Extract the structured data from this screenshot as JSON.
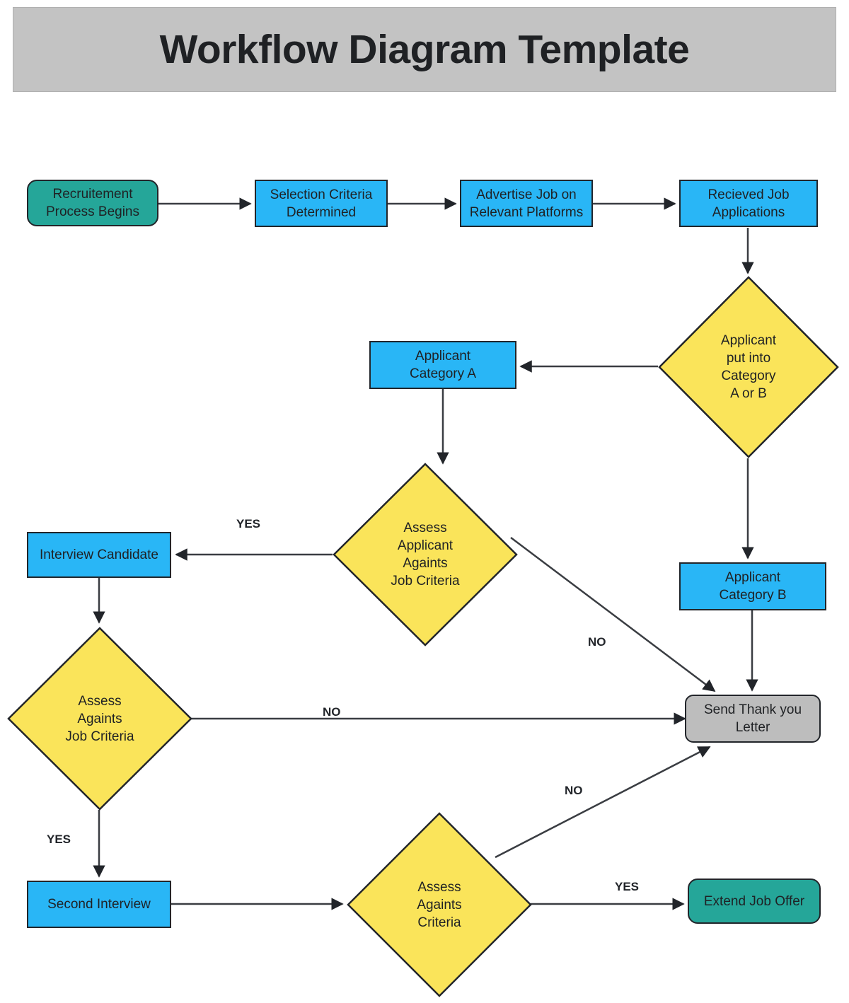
{
  "title": {
    "text": "Workflow Diagram Template"
  },
  "palette": {
    "start_end": "#25a699",
    "process": "#29b6f6",
    "decision": "#fae45a",
    "terminal_gray": "#bdbdbd",
    "banner": "#c3c3c3",
    "stroke": "#22252a",
    "text": "#1f2124"
  },
  "nodes": [
    {
      "id": "recruitment-process-begins",
      "shape": "rounded-rect",
      "color": "start_end",
      "label": "Recruitement\nProcess Begins"
    },
    {
      "id": "selection-criteria-determined",
      "shape": "rect",
      "color": "process",
      "label": "Selection Criteria\nDetermined"
    },
    {
      "id": "advertise-job",
      "shape": "rect",
      "color": "process",
      "label": "Advertise Job on\nRelevant Platforms"
    },
    {
      "id": "recieved-job-applications",
      "shape": "rect",
      "color": "process",
      "label": "Recieved Job\nApplications"
    },
    {
      "id": "applicant-put-into-category",
      "shape": "diamond",
      "color": "decision",
      "label": "Applicant\nput into\nCategory\nA or B"
    },
    {
      "id": "applicant-category-a",
      "shape": "rect",
      "color": "process",
      "label": "Applicant\nCategory A"
    },
    {
      "id": "applicant-category-b",
      "shape": "rect",
      "color": "process",
      "label": "Applicant\nCategory B"
    },
    {
      "id": "assess-applicant-againts-job-criteria",
      "shape": "diamond",
      "color": "decision",
      "label": "Assess\nApplicant\nAgaints\nJob Criteria"
    },
    {
      "id": "interview-candidate",
      "shape": "rect",
      "color": "process",
      "label": "Interview Candidate"
    },
    {
      "id": "assess-againts-job-criteria",
      "shape": "diamond",
      "color": "decision",
      "label": "Assess\nAgaints\nJob Criteria"
    },
    {
      "id": "send-thank-you-letter",
      "shape": "rounded-rect",
      "color": "terminal_gray",
      "label": "Send Thank you\nLetter"
    },
    {
      "id": "second-interview",
      "shape": "rect",
      "color": "process",
      "label": "Second Interview"
    },
    {
      "id": "assess-againts-criteria",
      "shape": "diamond",
      "color": "decision",
      "label": "Assess\nAgaints\nCriteria"
    },
    {
      "id": "extend-job-offer",
      "shape": "rounded-rect",
      "color": "start_end",
      "label": "Extend Job Offer"
    }
  ],
  "node_labels": {
    "recruitment_process_begins_line1": "Recruitement",
    "recruitment_process_begins_line2": "Process Begins",
    "selection_criteria_line1": "Selection Criteria",
    "selection_criteria_line2": "Determined",
    "advertise_job_line1": "Advertise Job on",
    "advertise_job_line2": "Relevant Platforms",
    "recieved_applications_line1": "Recieved Job",
    "recieved_applications_line2": "Applications",
    "applicant_put_into_category": "Applicant\nput into\nCategory\nA or B",
    "applicant_category_a_line1": "Applicant",
    "applicant_category_a_line2": "Category A",
    "applicant_category_b_line1": "Applicant",
    "applicant_category_b_line2": "Category B",
    "assess_applicant_againts_job_criteria": "Assess\nApplicant\nAgaints\nJob Criteria",
    "interview_candidate": "Interview Candidate",
    "assess_againts_job_criteria": "Assess\nAgaints\nJob Criteria",
    "send_thank_you_letter_line1": "Send Thank you",
    "send_thank_you_letter_line2": "Letter",
    "second_interview": "Second Interview",
    "assess_againts_criteria": "Assess\nAgaints\nCriteria",
    "extend_job_offer": "Extend Job Offer"
  },
  "edge_labels": {
    "yes_interview": "YES",
    "no_assess_applicant": "NO",
    "no_assess_againts_job": "NO",
    "yes_second_interview": "YES",
    "no_assess_againts_criteria": "NO",
    "yes_extend_offer": "YES"
  }
}
